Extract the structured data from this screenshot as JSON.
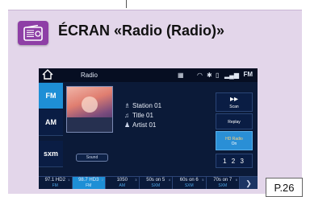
{
  "header": {
    "title": "ÉCRAN «Radio (Radio)»",
    "icon": "radio-icon",
    "icon_color": "#8e3fa6",
    "panel_color": "#e3d6ea"
  },
  "screen": {
    "status_bar": {
      "home_icon": "home-icon",
      "label": "Radio",
      "indicator": "FM"
    },
    "bands": [
      "FM",
      "AM",
      "sxm"
    ],
    "active_band": "FM",
    "now_playing": {
      "station": "Station 01",
      "title": "Title 01",
      "artist": "Artist 01"
    },
    "sound_button": "Sound",
    "right_buttons": {
      "scan": "Scan",
      "replay": "Replay",
      "hd_radio_line1": "HD Radio",
      "hd_radio_line2": "On",
      "pages": "1 2 3"
    },
    "presets": [
      {
        "freq": "97.1 HD2",
        "band": "FM",
        "num": "1"
      },
      {
        "freq": "98.7 HD3",
        "band": "FM",
        "num": "2"
      },
      {
        "freq": "1050",
        "band": "AM",
        "num": "3"
      },
      {
        "freq": "50s on 5",
        "band": "SXM",
        "num": "4"
      },
      {
        "freq": "60s on 6",
        "band": "SXM",
        "num": "5"
      },
      {
        "freq": "70s on 7",
        "band": "SXM",
        "num": "6"
      }
    ],
    "active_preset_index": 1,
    "accent_color": "#1e8fd6"
  },
  "page_reference": "P.26"
}
